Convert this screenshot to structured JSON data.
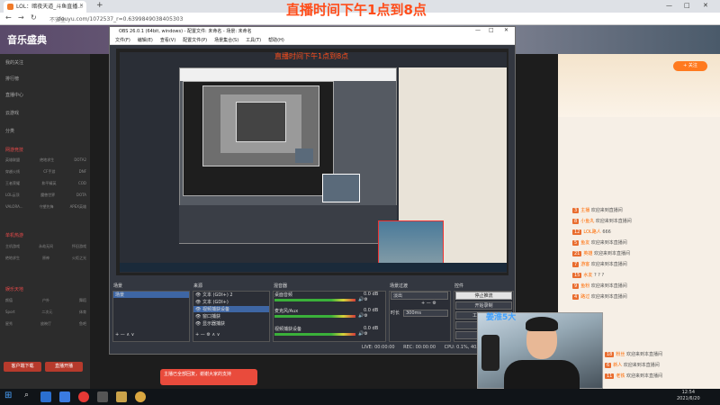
{
  "banner": "直播时间下午1点到8点",
  "browser": {
    "tab_title": "LOL：暗夜天道_斗鱼直播...",
    "url": "douyu.com/1072537_r=0.6399849038405303",
    "lock": "不安全",
    "new_tab": "+",
    "back": "←",
    "forward": "→",
    "reload": "↻"
  },
  "site": {
    "logo": "音乐盛典",
    "nav": [
      "我的关注",
      "排行榜",
      "直播中心",
      "云游戏",
      "分类"
    ],
    "section_games": "网游竞技",
    "games": [
      [
        "英雄联盟",
        "绝地求生",
        "DOTA2"
      ],
      [
        "穿越火线",
        "CF手游",
        "DNF"
      ],
      [
        "王者荣耀",
        "和平精英",
        "COD"
      ],
      [
        "LOL云顶",
        "魔兽世界",
        "DOTA"
      ],
      [
        "VALORA...",
        "守望先锋",
        "APEX英雄"
      ]
    ],
    "section_mobile": "单机热游",
    "mobile": [
      [
        "主机游戏",
        "永劫无间",
        "怀旧游戏"
      ],
      [
        "绝地求生",
        "原神",
        "火炬之光"
      ]
    ],
    "section_fun": "娱乐天地",
    "fun": [
      [
        "颜值",
        "户外",
        "舞蹈"
      ],
      [
        "Sport",
        "二次元",
        "体育"
      ],
      [
        "星秀",
        "放映厅",
        "鱼吧"
      ]
    ],
    "btn_left": "客户端下载",
    "btn_right": "直播开播",
    "follow": "+ 关注"
  },
  "chat": [
    {
      "badge": "3",
      "user": "主播",
      "text": "欢迎来到直播间"
    },
    {
      "badge": "8",
      "user": "小鱼丸",
      "text": "欢迎来到本直播间"
    },
    {
      "badge": "12",
      "user": "LOL路人",
      "text": "666"
    },
    {
      "badge": "5",
      "user": "鱼友",
      "text": "欢迎来到本直播间"
    },
    {
      "badge": "21",
      "user": "英雄",
      "text": "欢迎来到本直播间"
    },
    {
      "badge": "7",
      "user": "游客",
      "text": "欢迎来到本直播间"
    },
    {
      "badge": "15",
      "user": "水友",
      "text": "? ? ?"
    },
    {
      "badge": "9",
      "user": "鱼粉",
      "text": "欢迎来到本直播间"
    },
    {
      "badge": "4",
      "user": "路过",
      "text": "欢迎来到本直播间"
    },
    {
      "badge": "18",
      "user": "粉丝",
      "text": "欢迎来到本直播间"
    },
    {
      "badge": "6",
      "user": "新人",
      "text": "欢迎来到本直播间"
    },
    {
      "badge": "11",
      "user": "老铁",
      "text": "欢迎来到本直播间"
    }
  ],
  "obs": {
    "title": "OBS 26.0.1 (64bit, windows) - 配置文件: 未命名 - 场景: 未命名",
    "menu": [
      "文件(F)",
      "编辑(E)",
      "查看(V)",
      "配置文件(P)",
      "场景集合(S)",
      "工具(T)",
      "帮助(H)"
    ],
    "min": "—",
    "max": "□",
    "close": "✕",
    "docks": {
      "scene": "场景",
      "source": "来源",
      "mixer": "混音器",
      "transition": "场景过渡",
      "controls": "控件"
    },
    "scene_items": [
      "场景"
    ],
    "source_items": [
      "文本 (GDI+) 2",
      "文本 (GDI+)",
      "视频捕获设备",
      "窗口捕获",
      "显示器捕获"
    ],
    "mixer_items": [
      {
        "name": "桌面音频",
        "db": "0.0 dB"
      },
      {
        "name": "麦克风/Aux",
        "db": "0.0 dB"
      },
      {
        "name": "视频捕获设备",
        "db": "0.0 dB"
      }
    ],
    "transition": {
      "type": "淡出",
      "duration_label": "时长",
      "duration": "300ms"
    },
    "controls": [
      "停止推流",
      "开始录制",
      "工作室模式",
      "设置",
      "退出"
    ],
    "status": {
      "live": "LIVE: 00:00:00",
      "rec": "REC: 00:00:00",
      "cpu": "CPU: 0.1%, 40.00 fps"
    }
  },
  "webcam_overlay": "姜淮5大",
  "pinned_tip": "主播已全部回复，谢谢大家的支持",
  "clock": {
    "time": "12:54",
    "date": "2021/6/20"
  },
  "colors": {
    "accent": "#ff4d1a",
    "douyu_orange": "#ff7a1f",
    "obs_bg": "#333740"
  }
}
